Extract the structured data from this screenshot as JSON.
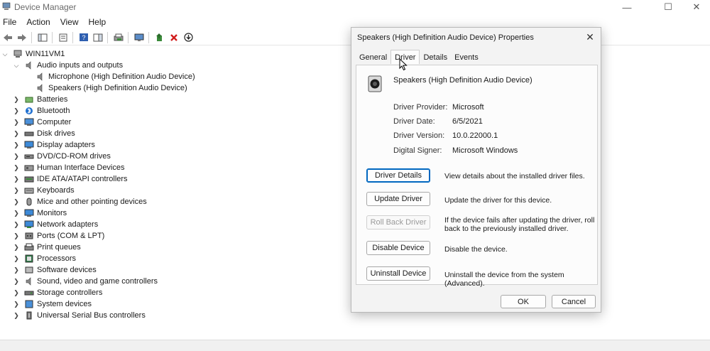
{
  "window": {
    "title": "Device Manager"
  },
  "window_controls": {
    "minimize": "—",
    "maximize": "☐",
    "close": "✕"
  },
  "menu": [
    "File",
    "Action",
    "View",
    "Help"
  ],
  "tree": {
    "root": "WIN11VM1",
    "audio_category": "Audio inputs and outputs",
    "audio_children": [
      "Microphone (High Definition Audio Device)",
      "Speakers (High Definition Audio Device)"
    ],
    "categories": [
      "Batteries",
      "Bluetooth",
      "Computer",
      "Disk drives",
      "Display adapters",
      "DVD/CD-ROM drives",
      "Human Interface Devices",
      "IDE ATA/ATAPI controllers",
      "Keyboards",
      "Mice and other pointing devices",
      "Monitors",
      "Network adapters",
      "Ports (COM & LPT)",
      "Print queues",
      "Processors",
      "Software devices",
      "Sound, video and game controllers",
      "Storage controllers",
      "System devices",
      "Universal Serial Bus controllers"
    ]
  },
  "dialog": {
    "title": "Speakers (High Definition Audio Device) Properties",
    "tabs": [
      "General",
      "Driver",
      "Details",
      "Events"
    ],
    "active_tab": "Driver",
    "device_name": "Speakers (High Definition Audio Device)",
    "props": [
      {
        "label": "Driver Provider:",
        "value": "Microsoft"
      },
      {
        "label": "Driver Date:",
        "value": "6/5/2021"
      },
      {
        "label": "Driver Version:",
        "value": "10.0.22000.1"
      },
      {
        "label": "Digital Signer:",
        "value": "Microsoft Windows"
      }
    ],
    "actions": [
      {
        "label": "Driver Details",
        "desc": "View details about the installed driver files."
      },
      {
        "label": "Update Driver",
        "desc": "Update the driver for this device."
      },
      {
        "label": "Roll Back Driver",
        "desc": "If the device fails after updating the driver, roll back to the previously installed driver."
      },
      {
        "label": "Disable Device",
        "desc": "Disable the device."
      },
      {
        "label": "Uninstall Device",
        "desc": "Uninstall the device from the system (Advanced)."
      }
    ],
    "ok_label": "OK",
    "cancel_label": "Cancel"
  },
  "colors": {
    "accent": "#0067c0",
    "disabled_text": "#9a9a9a",
    "dialog_bg": "#f3f3f3"
  }
}
